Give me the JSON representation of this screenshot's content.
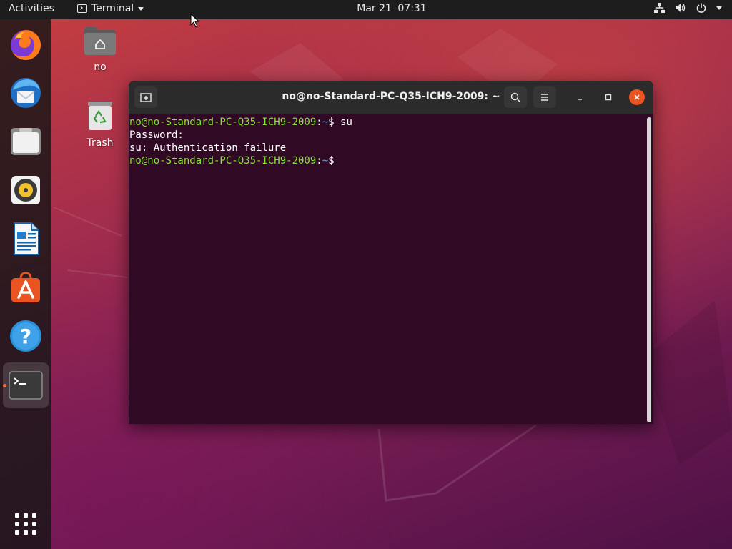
{
  "topbar": {
    "activities": "Activities",
    "app_name": "Terminal",
    "date": "Mar 21",
    "time": "07:31"
  },
  "dock": {
    "items": [
      {
        "name": "firefox",
        "icon": "firefox-icon"
      },
      {
        "name": "thunderbird",
        "icon": "thunderbird-icon"
      },
      {
        "name": "files",
        "icon": "files-icon"
      },
      {
        "name": "rhythmbox",
        "icon": "rhythmbox-icon"
      },
      {
        "name": "libreoffice-writer",
        "icon": "writer-icon"
      },
      {
        "name": "ubuntu-software",
        "icon": "software-icon"
      },
      {
        "name": "help",
        "icon": "help-icon"
      },
      {
        "name": "terminal",
        "icon": "terminal-icon",
        "active": true
      }
    ],
    "show_apps_icon": "app-grid-icon"
  },
  "desktop": {
    "icons": [
      {
        "label": "no",
        "icon": "home-folder-icon"
      },
      {
        "label": "Trash",
        "icon": "trash-icon"
      }
    ]
  },
  "terminal": {
    "title": "no@no-Standard-PC-Q35-ICH9-2009: ~",
    "lines": [
      {
        "user": "no@no-Standard-PC-Q35-ICH9-2009",
        "sep": ":",
        "path": "~",
        "cmd": "$ su"
      },
      {
        "text": "Password:"
      },
      {
        "text": "su: Authentication failure"
      },
      {
        "user": "no@no-Standard-PC-Q35-ICH9-2009",
        "sep": ":",
        "path": "~",
        "cmd": "$ "
      }
    ]
  },
  "colors": {
    "accent": "#e95420",
    "terminal_bg": "#300a24",
    "prompt_user": "#8ae234",
    "prompt_path": "#729fcf"
  }
}
